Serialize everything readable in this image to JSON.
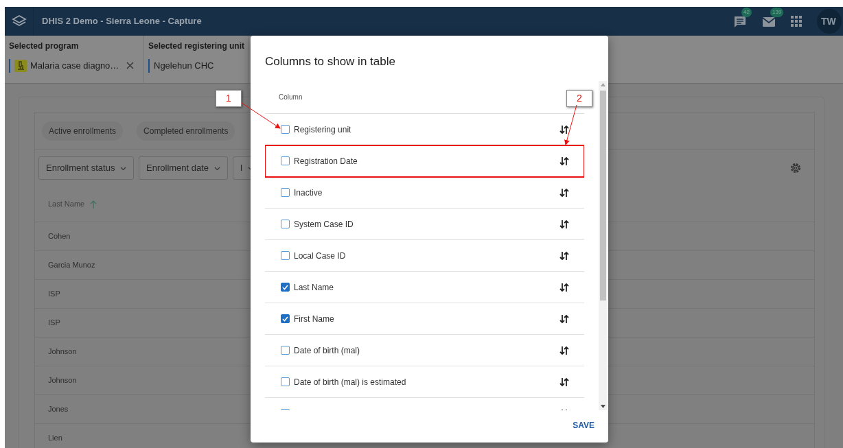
{
  "app_bar": {
    "title": "DHIS 2 Demo - Sierra Leone - Capture",
    "messages_count": "42",
    "email_count": "139",
    "avatar": "TW"
  },
  "context": [
    {
      "kind": "program",
      "label": "Selected program",
      "value": "Malaria case diagno…",
      "clearable": true
    },
    {
      "kind": "orgunit",
      "label": "Selected registering unit",
      "value": "Ngelehun CHC",
      "clearable": false
    }
  ],
  "list": {
    "tabs": [
      "Active enrollments",
      "Completed enrollments"
    ],
    "filters": [
      "Enrollment status",
      "Enrollment date",
      "I"
    ],
    "sort_column": "Last Name",
    "rows": [
      "Cohen",
      "Garcia Munoz",
      "ISP",
      "ISP",
      "Johnson",
      "Johnson",
      "Jones",
      "Lien"
    ]
  },
  "dialog": {
    "title": "Columns to show in table",
    "column_header": "Column",
    "columns": [
      {
        "label": "Registering unit",
        "checked": false,
        "highlighted": false
      },
      {
        "label": "Registration Date",
        "checked": false,
        "highlighted": true
      },
      {
        "label": "Inactive",
        "checked": false,
        "highlighted": false
      },
      {
        "label": "System Case ID",
        "checked": false,
        "highlighted": false
      },
      {
        "label": "Local Case ID",
        "checked": false,
        "highlighted": false
      },
      {
        "label": "Last Name",
        "checked": true,
        "highlighted": false
      },
      {
        "label": "First Name",
        "checked": true,
        "highlighted": false
      },
      {
        "label": "Date of birth (mal)",
        "checked": false,
        "highlighted": false
      },
      {
        "label": "Date of birth (mal) is estimated",
        "checked": false,
        "highlighted": false
      },
      {
        "checked": false,
        "highlighted": false
      }
    ],
    "save": "SAVE"
  },
  "annotations": [
    "1",
    "2"
  ]
}
